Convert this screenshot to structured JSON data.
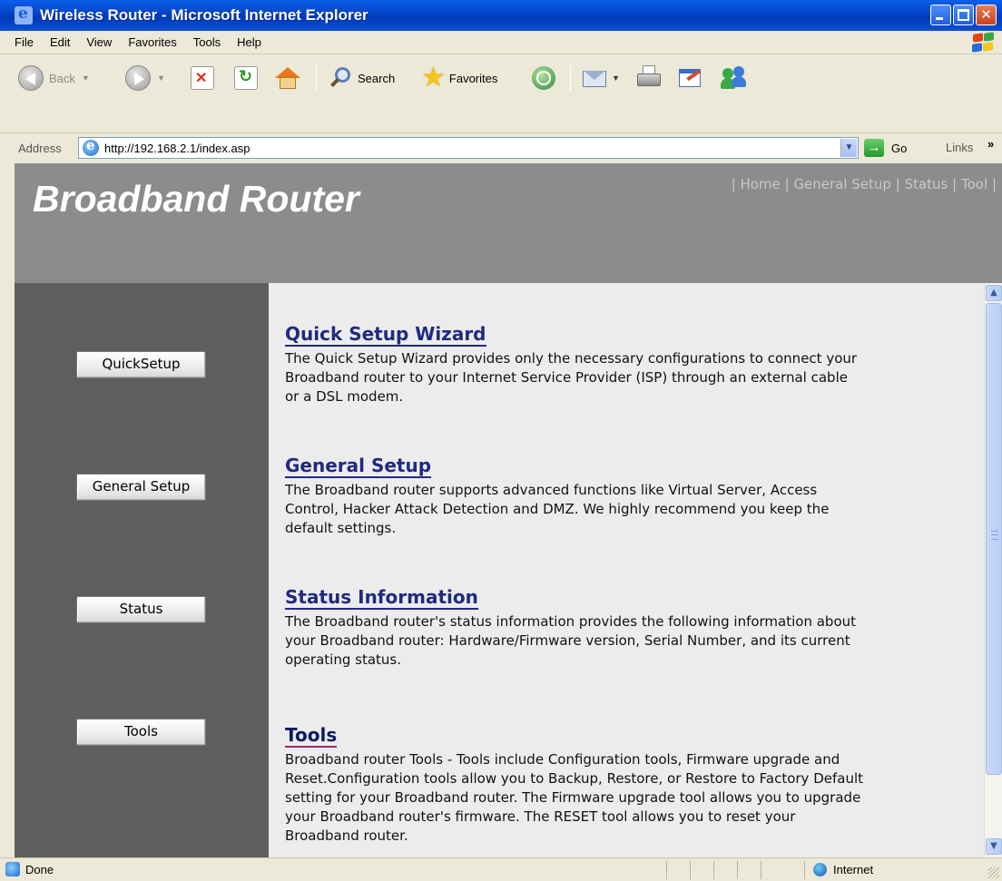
{
  "window": {
    "title": "Wireless Router - Microsoft Internet Explorer"
  },
  "menu": {
    "items": [
      {
        "label": "File"
      },
      {
        "label": "Edit"
      },
      {
        "label": "View"
      },
      {
        "label": "Favorites"
      },
      {
        "label": "Tools"
      },
      {
        "label": "Help"
      }
    ]
  },
  "toolbar": {
    "back_label": "Back",
    "search_label": "Search",
    "favorites_label": "Favorites"
  },
  "address": {
    "label": "Address",
    "url": "http://192.168.2.1/index.asp",
    "go_label": "Go",
    "links_label": "Links"
  },
  "page": {
    "brand": "Broadband Router",
    "nav": {
      "sep": "|",
      "home": "Home",
      "general_setup": "General Setup",
      "status": "Status",
      "tool": "Tool"
    },
    "sidebar_buttons": {
      "quicksetup": "QuickSetup",
      "general_setup": "General Setup",
      "status": "Status",
      "tools": "Tools"
    },
    "sections": [
      {
        "title": "Quick Setup Wizard",
        "body": "The Quick Setup Wizard provides only the necessary configurations to connect your Broadband router to your Internet Service Provider (ISP) through an external cable or a DSL modem."
      },
      {
        "title": "General Setup",
        "body": "The Broadband router supports advanced functions like Virtual Server, Access Control, Hacker Attack Detection and DMZ. We highly recommend you keep the default settings."
      },
      {
        "title": "Status Information",
        "body": "The Broadband router's status information provides the following information about your Broadband router: Hardware/Firmware version, Serial Number, and its current operating status."
      },
      {
        "title": "Tools",
        "body": "Broadband router Tools - Tools include Configuration tools, Firmware upgrade and Reset.Configuration tools allow you to Backup, Restore, or Restore to Factory Default setting for your Broadband router. The Firmware upgrade tool allows you to upgrade your Broadband router's firmware. The RESET tool allows you to reset your Broadband router."
      }
    ]
  },
  "status_bar": {
    "text": "Done",
    "zone": "Internet"
  }
}
